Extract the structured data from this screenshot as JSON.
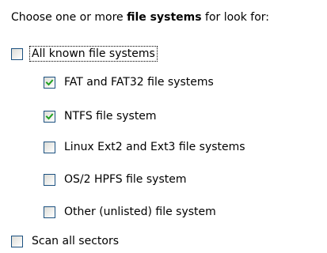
{
  "instruction": {
    "prefix": "Choose one or more ",
    "bold": "file systems",
    "suffix": " for look for:"
  },
  "options": [
    {
      "label": "All known file systems",
      "checked": false
    },
    {
      "label": "FAT and FAT32 file systems",
      "checked": true
    },
    {
      "label": "NTFS file system",
      "checked": true
    },
    {
      "label": "Linux Ext2 and Ext3 file systems",
      "checked": false
    },
    {
      "label": "OS/2 HPFS file system",
      "checked": false
    },
    {
      "label": "Other (unlisted) file system",
      "checked": false
    },
    {
      "label": "Scan all sectors",
      "checked": false
    }
  ],
  "colors": {
    "checkbox_border": "#1c5180",
    "checkmark": "#21a121"
  }
}
